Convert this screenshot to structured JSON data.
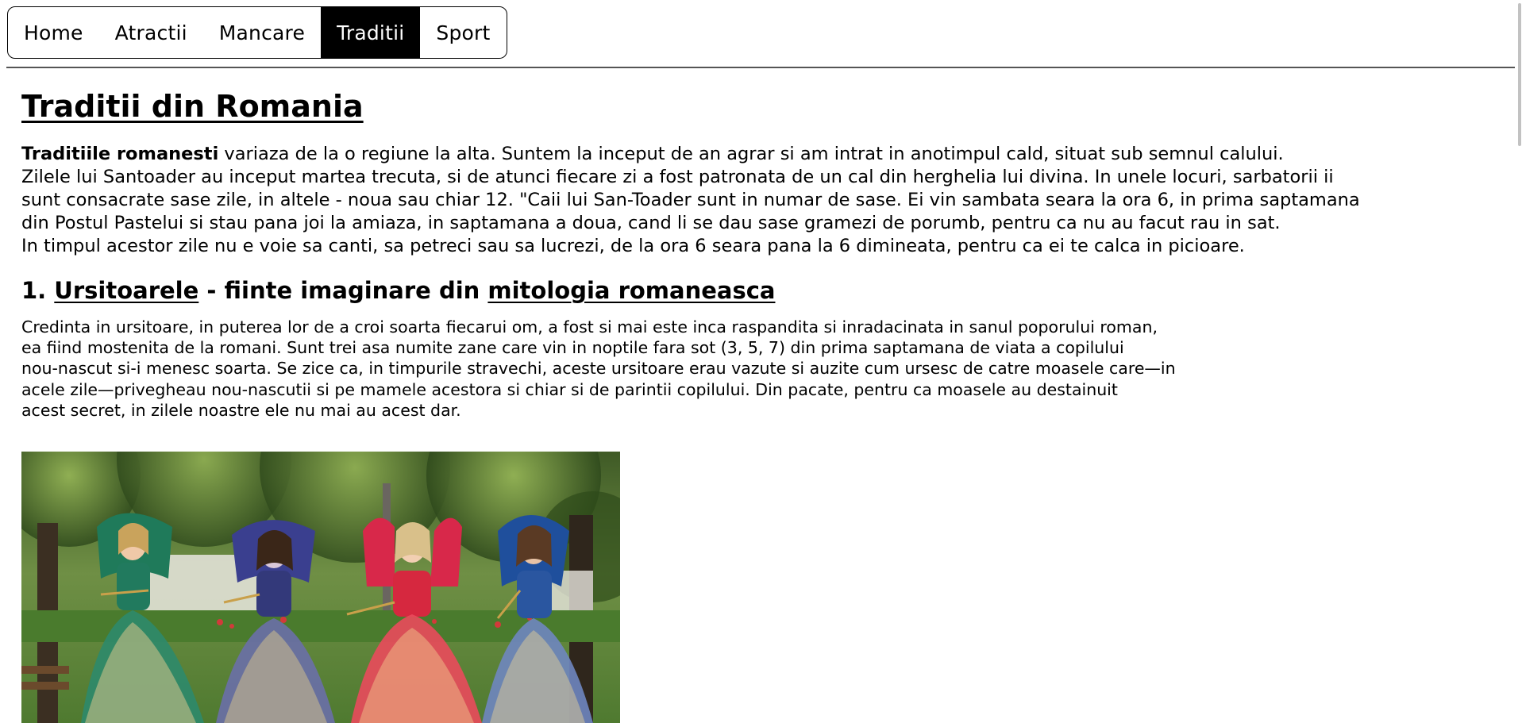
{
  "nav": {
    "items": [
      {
        "label": "Home",
        "active": false
      },
      {
        "label": "Atractii",
        "active": false
      },
      {
        "label": "Mancare",
        "active": false
      },
      {
        "label": "Traditii",
        "active": true
      },
      {
        "label": "Sport",
        "active": false
      }
    ]
  },
  "page": {
    "title": "Traditii din Romania",
    "intro": {
      "lead": "Traditiile romanesti",
      "line1": " variaza de la o regiune la alta. Suntem la inceput de an agrar si am intrat in anotimpul cald, situat sub semnul calului.",
      "line2": "Zilele lui Santoader au inceput martea trecuta, si de atunci fiecare zi a fost patronata de un cal din herghelia lui divina. In unele locuri, sarbatorii ii",
      "line3": "sunt consacrate sase zile, in altele - noua sau chiar 12. \"Caii lui San-Toader sunt in numar de sase. Ei vin sambata seara la ora 6, in prima saptamana",
      "line4": "din Postul Pastelui si stau pana joi la amiaza, in saptamana a doua, cand li se dau sase gramezi de porumb, pentru ca nu au facut rau in sat.",
      "line5": "In timpul acestor zile nu e voie sa canti, sa petreci sau sa lucrezi, de la ora 6 seara pana la 6 dimineata, pentru ca ei te calca in picioare."
    },
    "section1": {
      "number": "1. ",
      "link1": "Ursitoarele",
      "middle": " - fiinte imaginare din ",
      "link2": "mitologia romaneasca",
      "lines": [
        "Credinta in ursitoare, in puterea lor de a croi soarta fiecarui om, a fost si mai este inca raspandita si inradacinata in sanul poporului roman,",
        "ea fiind mostenita de la romani. Sunt trei asa numite zane care vin in noptile fara sot (3, 5, 7) din prima saptamana de viata a copilului",
        "nou-nascut si-i menesc soarta. Se zice ca, in timpurile stravechi, aceste ursitoare erau vazute si auzite cum ursesc de catre moasele care—in",
        "acele zile—privegheau nou-nascutii si pe mamele acestora si chiar si de parintii copilului. Din pacate, pentru ca moasele au destainuit",
        "acest secret, in zilele noastre ele nu mai au acest dar."
      ]
    },
    "image": {
      "subject": "ursitoare-costumes-photo"
    }
  },
  "colors": {
    "active_tab_bg": "#000000",
    "active_tab_text": "#ffffff",
    "text": "#000000"
  }
}
